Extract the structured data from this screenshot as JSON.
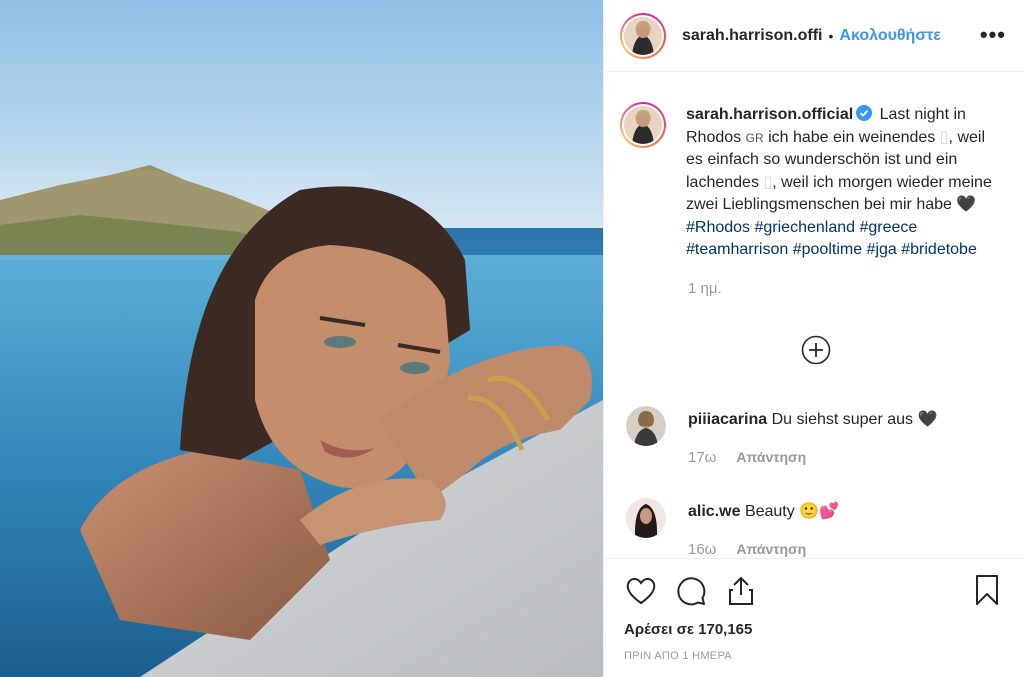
{
  "header": {
    "username": "sarah.harrison.offi",
    "separator": "•",
    "follow_label": "Ακολουθήστε",
    "more_label": "•••"
  },
  "caption": {
    "username": "sarah.harrison.official",
    "text_1": "Last night in Rhodos",
    "flag": "GR",
    "text_2": "ich habe ein weinendes",
    "text_3": ", weil es einfach so wunderschön ist und ein lachendes",
    "text_4": ", weil ich morgen wieder meine zwei Lieblingsmenschen bei mir habe",
    "heart": "🖤",
    "hashtags": "#Rhodos #griechenland #greece #teamharrison #pooltime #jga #bridetobe",
    "time": "1 ημ."
  },
  "comments": [
    {
      "username": "piiiacarina",
      "text": "Du siehst super aus 🖤",
      "time": "17ω",
      "reply": "Απάντηση"
    },
    {
      "username": "alic.we",
      "text": "Beauty 🙂💕",
      "time": "16ω",
      "reply": "Απάντηση"
    }
  ],
  "actions": {
    "likes": "Αρέσει σε 170,165",
    "posted": "ΠΡΙΝ ΑΠΟ 1 ΗΜΕΡΑ"
  },
  "icons": [
    "heart-icon",
    "comment-icon",
    "share-icon",
    "bookmark-icon",
    "plus-circle-icon",
    "verified-icon",
    "more-icon"
  ]
}
